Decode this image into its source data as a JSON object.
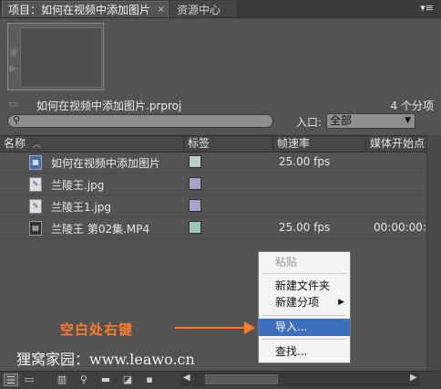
{
  "tabs": [
    {
      "label": "项目：如何在视频中添加图片",
      "close": "×"
    },
    {
      "label": "资源中心"
    }
  ],
  "panel_menu": "▾≡",
  "project": {
    "name": "如何在视频中添加图片.prproj",
    "count": "4 个分项"
  },
  "search": {
    "placeholder": "",
    "icon": "search-icon"
  },
  "in_point": {
    "label": "入口:",
    "value": "全部"
  },
  "columns": {
    "name": "名称",
    "label": "标签",
    "fps": "帧速率",
    "start": "媒体开始点"
  },
  "rows": [
    {
      "name": "如何在视频中添加图片",
      "color": "#b9cfc9",
      "fps": "25.00 fps",
      "start": "",
      "icon": "sequence-icon"
    },
    {
      "name": "兰陵王.jpg",
      "color": "#a99fc9",
      "fps": "",
      "start": "",
      "icon": "image-file-icon"
    },
    {
      "name": "兰陵王1.jpg",
      "color": "#a99fc9",
      "fps": "",
      "start": "",
      "icon": "image-file-icon"
    },
    {
      "name": "兰陵王 第02集.MP4",
      "color": "#9fc7bd",
      "fps": "25.00 fps",
      "start": "00:00:00:0",
      "icon": "video-file-icon"
    }
  ],
  "context_menu": {
    "paste": "粘贴",
    "new_bin": "新建文件夹",
    "new_item": "新建分项",
    "import": "导入...",
    "find": "查找..."
  },
  "annotation": "空白处右键",
  "watermark": "狸窝家园：www.leawo.cn"
}
